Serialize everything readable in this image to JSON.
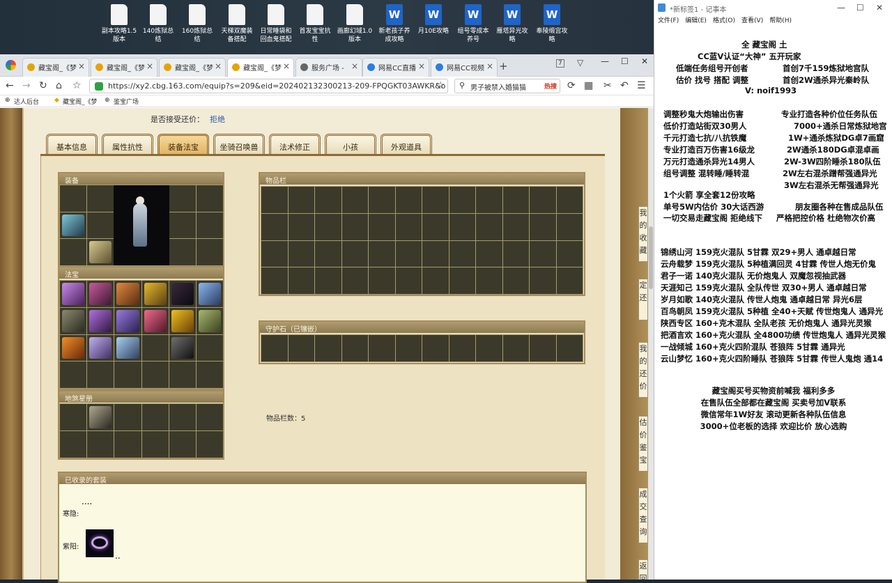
{
  "desktop": {
    "icons": [
      {
        "label": "副本攻略1.5版本",
        "kind": "txt"
      },
      {
        "label": "140炼狱总结",
        "kind": "txt"
      },
      {
        "label": "160炼狱总结",
        "kind": "txt"
      },
      {
        "label": "天梯双魔装备搭配",
        "kind": "txt"
      },
      {
        "label": "日常睡袋和回血鬼搭配",
        "kind": "txt"
      },
      {
        "label": "首发宝宝抗性",
        "kind": "txt"
      },
      {
        "label": "画廊幻域1.0版本",
        "kind": "txt"
      },
      {
        "label": "新老孩子养成攻略",
        "kind": "doc"
      },
      {
        "label": "月10E攻略",
        "kind": "doc"
      },
      {
        "label": "组号零成本养号",
        "kind": "doc"
      },
      {
        "label": "雁塔异光攻略",
        "kind": "doc"
      },
      {
        "label": "奉陵缎宫攻略",
        "kind": "doc"
      }
    ]
  },
  "browser": {
    "tabs": [
      {
        "label": "藏宝阁_《梦",
        "active": false
      },
      {
        "label": "藏宝阁_《梦",
        "active": false
      },
      {
        "label": "藏宝阁_《梦",
        "active": false
      },
      {
        "label": "藏宝阁_《梦",
        "active": true
      },
      {
        "label": "服务广场 -",
        "active": false
      },
      {
        "label": "网易CC直播",
        "active": false
      },
      {
        "label": "网易CC视频",
        "active": false
      }
    ],
    "new_tab": "+",
    "url": "https://xy2.cbg.163.com/equip?s=209&eid=202402132300213-209-FPQGKT03AWKR&o",
    "search_text": "男子被禁入婚猫猫",
    "search_hot": "热搜",
    "bookmarks": [
      "达人后台",
      "藏宝阁_《梦",
      "鉴宝广场"
    ],
    "tab_count": "7"
  },
  "cbg": {
    "bargain_label": "是否接受还价：",
    "bargain_value": "拒绝",
    "tabs": [
      "基本信息",
      "属性抗性",
      "装备法宝",
      "坐骑召唤兽",
      "法术修正",
      "小孩",
      "外观道具"
    ],
    "active_tab": "装备法宝",
    "sections": {
      "equip": "装备",
      "fabao": "法宝",
      "dizang": "地煞星册",
      "inventory": "物品栏",
      "guardian": "守护石（已镶嵌）",
      "collected": "已收录的套装"
    },
    "inventory_count_label": "物品栏数：5",
    "collected_rows": [
      {
        "label": "寒隐:",
        "dots": "...."
      },
      {
        "label": "紫阳:",
        "dots": ".."
      }
    ],
    "side_text": [
      "我的收藏",
      "定还",
      "我的还价",
      "估价鉴宝",
      "成交查询",
      "返回"
    ],
    "colors": {
      "accent": "#e1b565",
      "section_header": "#9e8a5e",
      "slot": "#3b3a2a"
    }
  },
  "notepad": {
    "title": "*新标签1 - 记事本",
    "menu": [
      "文件(F)",
      "编辑(E)",
      "格式(O)",
      "查看(V)",
      "帮助(H)"
    ],
    "header_lines": [
      "全 藏宝阁 土",
      "CC蓝V认证“大神”  五开玩家",
      "低端任务组号开创者",
      "首创7千159炼狱地宫队",
      "估价 找号 搭配 调整",
      "首创2W通杀异光秦岭队",
      "V:  noif1993"
    ],
    "services_left": [
      "调整秒鬼大炮输出伤害",
      "低价打造站街双30男人",
      "千元打造七抗/八抗铁魔",
      "专业打造百万伤害16级龙",
      "万元打造通杀异光14男人",
      "组号调整 混转睡/睡转混"
    ],
    "services_right": [
      "专业打造各种价位任务队伍",
      "7000+通杀日常炼狱地宫",
      "1W+通杀炼狱DG卓7画窟",
      "2W通杀180DG卓混卓画",
      "2W-3W四阶睡杀180队伍",
      "2W左右混杀蹭帮强通异光",
      "3W左右混杀无帮强通异光"
    ],
    "misc": [
      "1个火箭 享全套12份攻略",
      "单号5W内估价 30大话西游",
      "朋友圈各种在售成品队伍",
      "一切交易走藏宝阁 拒绝线下",
      "严格把控价格 杜绝物次价高"
    ],
    "teams": [
      "锦绣山河 159克火混队 5甘霖 双29+男人 通卓越日常",
      "云舟载梦 159克火混队 5种植满回灵 4甘霖 传世人炮无价鬼",
      "君子一诺 140克火混队 无价炮鬼人 双魔忽视抽武器",
      "天涯知己 159克火混队 全队传世 双30+男人 通卓越日常",
      "岁月如歌 140克火混队 传世人炮鬼 通卓越日常 异光6层",
      "百鸟朝凤 159克火混队 5种植 全40+天赋 传世炮鬼人 通异光",
      "陕西专区 160+克木混队 全队老孩 无价炮鬼人 通异光灵猴",
      "把酒言欢 160+克火混队 全4800功绩 传世炮鬼人 通异光灵猴",
      "一战倾城 160+克火四阶混队 苍狼阵 5甘霖 通异光",
      "云山梦忆 160+克火四阶睡队 苍狼阵 5甘霖 传世人鬼炮 通14"
    ],
    "footer": [
      "藏宝阁买号买物资前喊我 福利多多",
      "在售队伍全部都在藏宝阁 买卖号加V联系",
      "微信常年1W好友 滚动更新各种队伍信息",
      "3000+位老板的选择 欢迎比价 放心选购"
    ]
  }
}
